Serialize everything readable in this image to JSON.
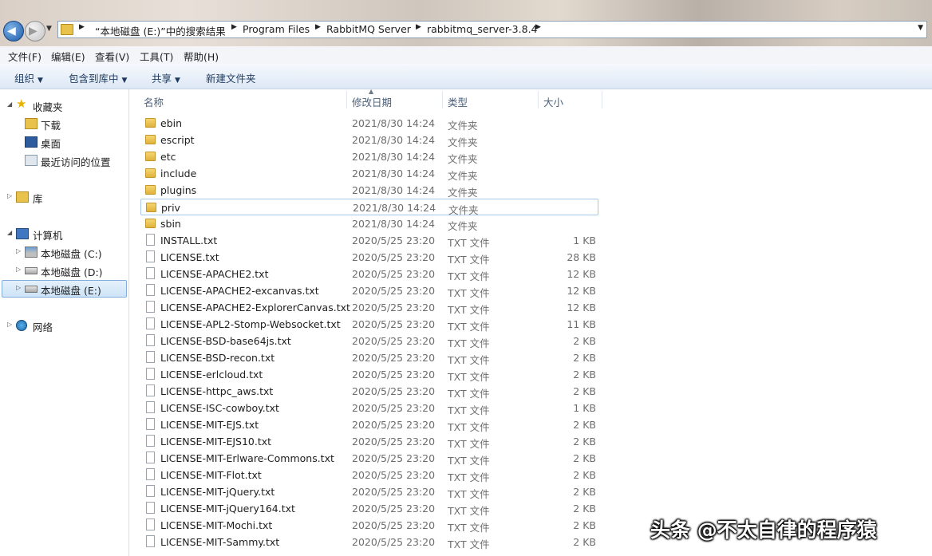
{
  "address": {
    "crumbs": [
      "“本地磁盘 (E:)”中的搜索结果",
      "Program Files",
      "RabbitMQ Server",
      "rabbitmq_server-3.8.4"
    ]
  },
  "menu": [
    "文件(F)",
    "编辑(E)",
    "查看(V)",
    "工具(T)",
    "帮助(H)"
  ],
  "toolbar": {
    "organize": "组织",
    "include_library": "包含到库中",
    "share": "共享",
    "new_folder": "新建文件夹"
  },
  "nav": {
    "favorites": "收藏夹",
    "downloads": "下载",
    "desktop": "桌面",
    "recent": "最近访问的位置",
    "libraries": "库",
    "computer": "计算机",
    "drive_c": "本地磁盘 (C:)",
    "drive_d": "本地磁盘 (D:)",
    "drive_e": "本地磁盘 (E:)",
    "network": "网络"
  },
  "columns": {
    "name": "名称",
    "date": "修改日期",
    "type": "类型",
    "size": "大小"
  },
  "files": [
    {
      "name": "ebin",
      "date": "2021/8/30 14:24",
      "type": "文件夹",
      "size": "",
      "kind": "folder"
    },
    {
      "name": "escript",
      "date": "2021/8/30 14:24",
      "type": "文件夹",
      "size": "",
      "kind": "folder"
    },
    {
      "name": "etc",
      "date": "2021/8/30 14:24",
      "type": "文件夹",
      "size": "",
      "kind": "folder"
    },
    {
      "name": "include",
      "date": "2021/8/30 14:24",
      "type": "文件夹",
      "size": "",
      "kind": "folder"
    },
    {
      "name": "plugins",
      "date": "2021/8/30 14:24",
      "type": "文件夹",
      "size": "",
      "kind": "folder"
    },
    {
      "name": "priv",
      "date": "2021/8/30 14:24",
      "type": "文件夹",
      "size": "",
      "kind": "folder",
      "highlighted": true
    },
    {
      "name": "sbin",
      "date": "2021/8/30 14:24",
      "type": "文件夹",
      "size": "",
      "kind": "folder"
    },
    {
      "name": "INSTALL.txt",
      "date": "2020/5/25 23:20",
      "type": "TXT 文件",
      "size": "1 KB",
      "kind": "file"
    },
    {
      "name": "LICENSE.txt",
      "date": "2020/5/25 23:20",
      "type": "TXT 文件",
      "size": "28 KB",
      "kind": "file"
    },
    {
      "name": "LICENSE-APACHE2.txt",
      "date": "2020/5/25 23:20",
      "type": "TXT 文件",
      "size": "12 KB",
      "kind": "file"
    },
    {
      "name": "LICENSE-APACHE2-excanvas.txt",
      "date": "2020/5/25 23:20",
      "type": "TXT 文件",
      "size": "12 KB",
      "kind": "file"
    },
    {
      "name": "LICENSE-APACHE2-ExplorerCanvas.txt",
      "date": "2020/5/25 23:20",
      "type": "TXT 文件",
      "size": "12 KB",
      "kind": "file"
    },
    {
      "name": "LICENSE-APL2-Stomp-Websocket.txt",
      "date": "2020/5/25 23:20",
      "type": "TXT 文件",
      "size": "11 KB",
      "kind": "file"
    },
    {
      "name": "LICENSE-BSD-base64js.txt",
      "date": "2020/5/25 23:20",
      "type": "TXT 文件",
      "size": "2 KB",
      "kind": "file"
    },
    {
      "name": "LICENSE-BSD-recon.txt",
      "date": "2020/5/25 23:20",
      "type": "TXT 文件",
      "size": "2 KB",
      "kind": "file"
    },
    {
      "name": "LICENSE-erlcloud.txt",
      "date": "2020/5/25 23:20",
      "type": "TXT 文件",
      "size": "2 KB",
      "kind": "file"
    },
    {
      "name": "LICENSE-httpc_aws.txt",
      "date": "2020/5/25 23:20",
      "type": "TXT 文件",
      "size": "2 KB",
      "kind": "file"
    },
    {
      "name": "LICENSE-ISC-cowboy.txt",
      "date": "2020/5/25 23:20",
      "type": "TXT 文件",
      "size": "1 KB",
      "kind": "file"
    },
    {
      "name": "LICENSE-MIT-EJS.txt",
      "date": "2020/5/25 23:20",
      "type": "TXT 文件",
      "size": "2 KB",
      "kind": "file"
    },
    {
      "name": "LICENSE-MIT-EJS10.txt",
      "date": "2020/5/25 23:20",
      "type": "TXT 文件",
      "size": "2 KB",
      "kind": "file"
    },
    {
      "name": "LICENSE-MIT-Erlware-Commons.txt",
      "date": "2020/5/25 23:20",
      "type": "TXT 文件",
      "size": "2 KB",
      "kind": "file"
    },
    {
      "name": "LICENSE-MIT-Flot.txt",
      "date": "2020/5/25 23:20",
      "type": "TXT 文件",
      "size": "2 KB",
      "kind": "file"
    },
    {
      "name": "LICENSE-MIT-jQuery.txt",
      "date": "2020/5/25 23:20",
      "type": "TXT 文件",
      "size": "2 KB",
      "kind": "file"
    },
    {
      "name": "LICENSE-MIT-jQuery164.txt",
      "date": "2020/5/25 23:20",
      "type": "TXT 文件",
      "size": "2 KB",
      "kind": "file"
    },
    {
      "name": "LICENSE-MIT-Mochi.txt",
      "date": "2020/5/25 23:20",
      "type": "TXT 文件",
      "size": "2 KB",
      "kind": "file"
    },
    {
      "name": "LICENSE-MIT-Sammy.txt",
      "date": "2020/5/25 23:20",
      "type": "TXT 文件",
      "size": "2 KB",
      "kind": "file"
    }
  ],
  "watermark": "头条 @不太自律的程序猿"
}
